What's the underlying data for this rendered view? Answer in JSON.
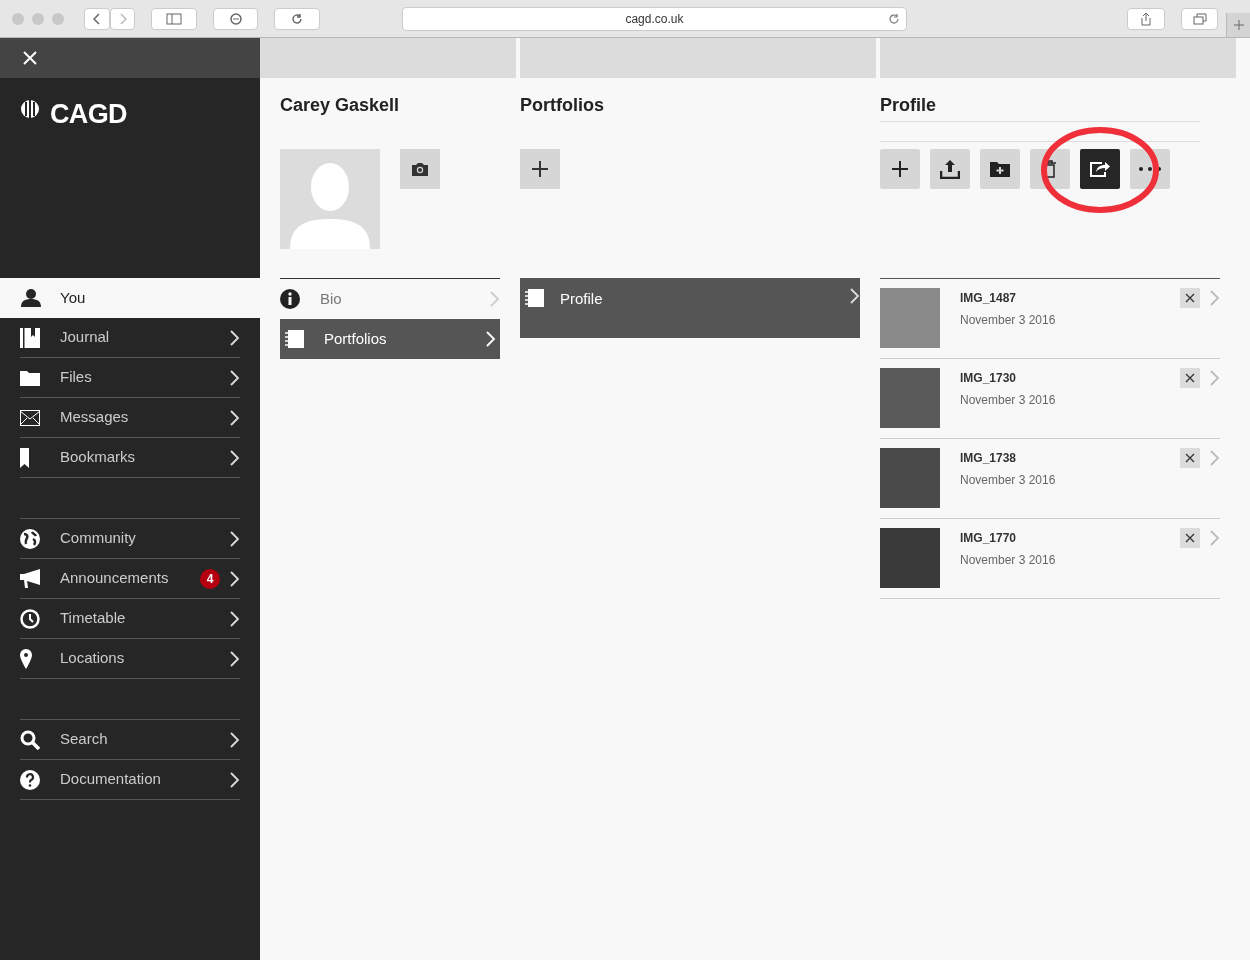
{
  "browser": {
    "url": "cagd.co.uk"
  },
  "sidebar": {
    "logo": "CAGD",
    "groups": [
      [
        {
          "label": "You",
          "selected": true
        },
        {
          "label": "Journal",
          "selected": false
        },
        {
          "label": "Files",
          "selected": false
        },
        {
          "label": "Messages",
          "selected": false
        },
        {
          "label": "Bookmarks",
          "selected": false
        }
      ],
      [
        {
          "label": "Community",
          "selected": false
        },
        {
          "label": "Announcements",
          "selected": false,
          "badge": "4"
        },
        {
          "label": "Timetable",
          "selected": false
        },
        {
          "label": "Locations",
          "selected": false
        }
      ],
      [
        {
          "label": "Search",
          "selected": false
        },
        {
          "label": "Documentation",
          "selected": false
        }
      ]
    ]
  },
  "user_column": {
    "title": "Carey Gaskell",
    "items": [
      {
        "label": "Bio",
        "selected": false
      },
      {
        "label": "Portfolios",
        "selected": true
      }
    ]
  },
  "portfolios_column": {
    "title": "Portfolios",
    "items": [
      {
        "label": "Profile",
        "selected": true
      }
    ]
  },
  "profile_column": {
    "title": "Profile",
    "toolbar": [
      {
        "selected": false
      },
      {
        "selected": false
      },
      {
        "selected": false
      },
      {
        "selected": false
      },
      {
        "selected": true
      },
      {
        "selected": false
      }
    ],
    "images": [
      {
        "name": "IMG_1487",
        "date": "November 3 2016"
      },
      {
        "name": "IMG_1730",
        "date": "November 3 2016"
      },
      {
        "name": "IMG_1738",
        "date": "November 3 2016"
      },
      {
        "name": "IMG_1770",
        "date": "November 3 2016"
      }
    ]
  }
}
